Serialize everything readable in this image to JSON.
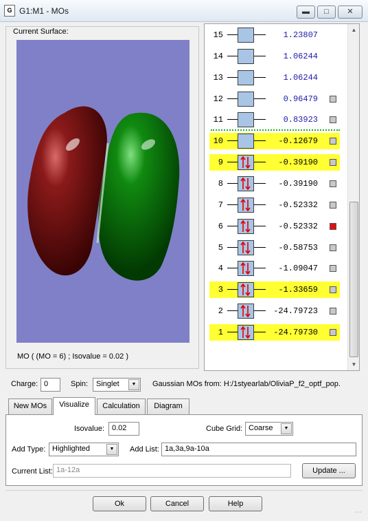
{
  "window": {
    "title": "G1:M1 - MOs",
    "icon": "gaussview-doc-icon"
  },
  "surface": {
    "group_label": "Current Surface:",
    "caption": "MO ( (MO = 6) ; Isovalue = 0.02 )"
  },
  "colors": {
    "canvas_bg": "#8080c8",
    "lobe_positive": "#8b1a1a",
    "lobe_negative": "#107a10",
    "highlight": "#ffff33",
    "occupied_box": "#a9c5e6",
    "selected_mo": "#e01010"
  },
  "mo_list": [
    {
      "idx": "15",
      "energy": "1.23807",
      "occupied": false,
      "highlight": false,
      "checkbox": false,
      "selected": false
    },
    {
      "idx": "14",
      "energy": "1.06244",
      "occupied": false,
      "highlight": false,
      "checkbox": false,
      "selected": false
    },
    {
      "idx": "13",
      "energy": "1.06244",
      "occupied": false,
      "highlight": false,
      "checkbox": false,
      "selected": false
    },
    {
      "idx": "12",
      "energy": "0.96479",
      "occupied": false,
      "highlight": false,
      "checkbox": true,
      "selected": false
    },
    {
      "idx": "11",
      "energy": "0.83923",
      "occupied": false,
      "highlight": false,
      "checkbox": true,
      "selected": false
    },
    {
      "idx": "10",
      "energy": "-0.12679",
      "occupied": false,
      "highlight": true,
      "checkbox": true,
      "selected": false
    },
    {
      "idx": "9",
      "energy": "-0.39190",
      "occupied": true,
      "highlight": true,
      "checkbox": true,
      "selected": false
    },
    {
      "idx": "8",
      "energy": "-0.39190",
      "occupied": true,
      "highlight": false,
      "checkbox": true,
      "selected": false
    },
    {
      "idx": "7",
      "energy": "-0.52332",
      "occupied": true,
      "highlight": false,
      "checkbox": true,
      "selected": false
    },
    {
      "idx": "6",
      "energy": "-0.52332",
      "occupied": true,
      "highlight": false,
      "checkbox": true,
      "selected": true
    },
    {
      "idx": "5",
      "energy": "-0.58753",
      "occupied": true,
      "highlight": false,
      "checkbox": true,
      "selected": false
    },
    {
      "idx": "4",
      "energy": "-1.09047",
      "occupied": true,
      "highlight": false,
      "checkbox": true,
      "selected": false
    },
    {
      "idx": "3",
      "energy": "-1.33659",
      "occupied": true,
      "highlight": true,
      "checkbox": true,
      "selected": false
    },
    {
      "idx": "2",
      "energy": "-24.79723",
      "occupied": true,
      "highlight": false,
      "checkbox": true,
      "selected": false
    },
    {
      "idx": "1",
      "energy": "-24.79730",
      "occupied": true,
      "highlight": true,
      "checkbox": true,
      "selected": false
    }
  ],
  "charge": {
    "label": "Charge:",
    "value": "0"
  },
  "spin": {
    "label": "Spin:",
    "value": "Singlet"
  },
  "gaussian_mos": {
    "text": "Gaussian MOs from:  H:/1styearlab/OliviaP_f2_optf_pop."
  },
  "tabs": [
    {
      "label": "New MOs",
      "active": false
    },
    {
      "label": "Visualize",
      "active": true
    },
    {
      "label": "Calculation",
      "active": false
    },
    {
      "label": "Diagram",
      "active": false
    }
  ],
  "visualize": {
    "isovalue_label": "Isovalue:",
    "isovalue": "0.02",
    "cube_grid_label": "Cube Grid:",
    "cube_grid": "Coarse",
    "add_type_label": "Add Type:",
    "add_type": "Highlighted",
    "add_list_label": "Add List:",
    "add_list": "1a,3a,9a-10a",
    "current_list_label": "Current List:",
    "current_list": "1a-12a",
    "update_label": "Update ..."
  },
  "buttons": {
    "ok": "Ok",
    "cancel": "Cancel",
    "help": "Help"
  }
}
